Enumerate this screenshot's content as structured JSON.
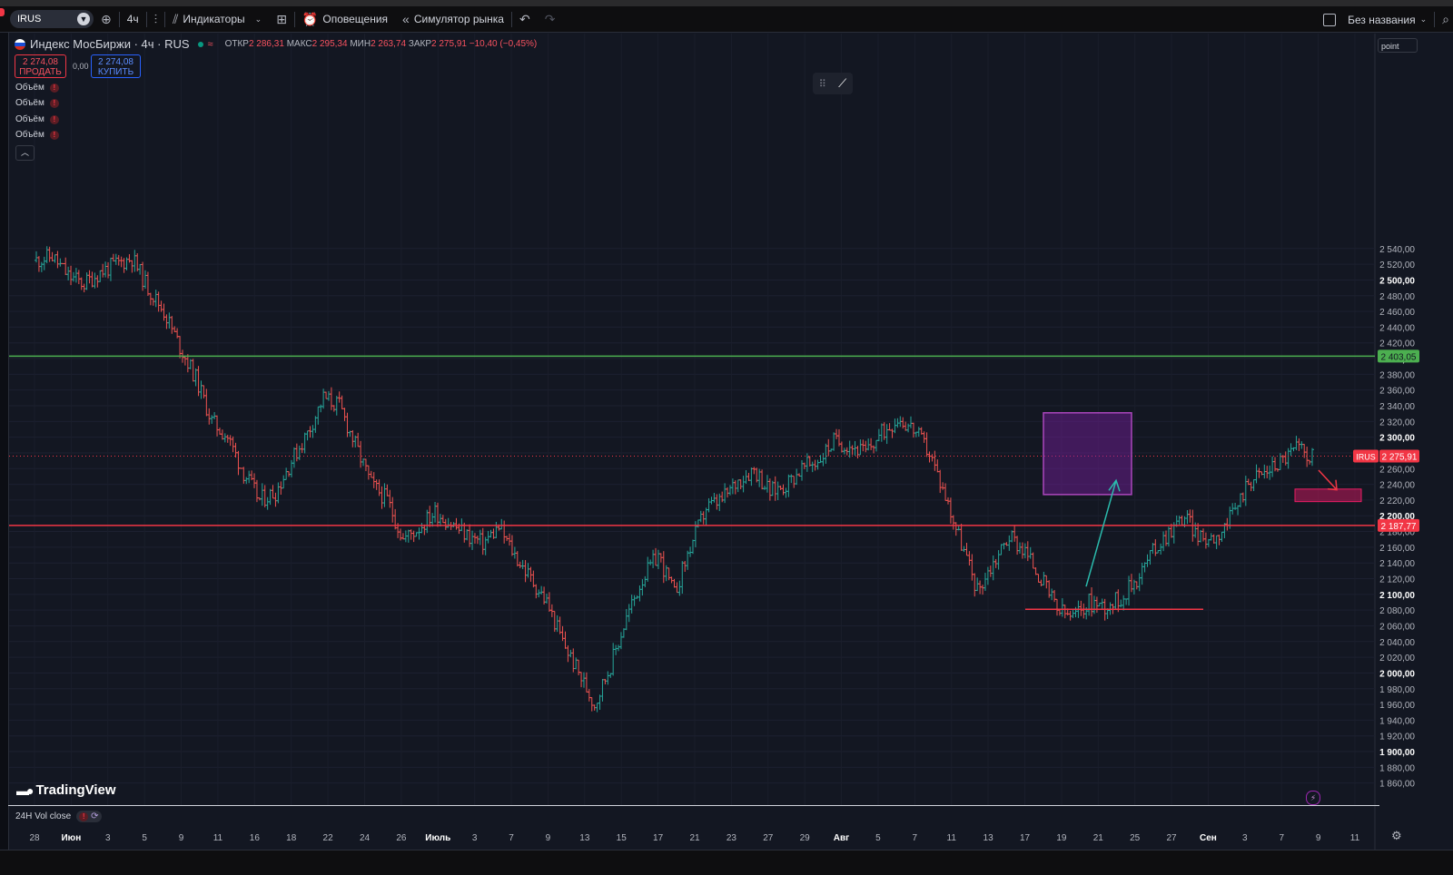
{
  "toolbar": {
    "symbol": "IRUS",
    "interval": "4ч",
    "indicators_label": "Индикаторы",
    "alerts_label": "Оповещения",
    "replay_label": "Симулятор рынка",
    "layout_name": "Без названия"
  },
  "legend": {
    "title": "Индекс МосБиржи · 4ч · RUS",
    "open_label": "ОТКР",
    "open": "2 286,31",
    "high_label": "МАКС",
    "high": "2 295,34",
    "low_label": "МИН",
    "low": "2 263,74",
    "close_label": "ЗАКР",
    "close": "2 275,91",
    "change": "−10,40 (−0,45%)",
    "approx_icon": "≈"
  },
  "trade": {
    "sell_price": "2 274,08",
    "sell_label": "ПРОДАТЬ",
    "spread": "0,00",
    "buy_price": "2 274,08",
    "buy_label": "КУПИТЬ"
  },
  "indicators": [
    {
      "label": "Объём"
    },
    {
      "label": "Объём"
    },
    {
      "label": "Объём"
    },
    {
      "label": "Объём"
    }
  ],
  "scale_mode": "point",
  "branding": "TradingView",
  "volume_pane": {
    "label": "24H Vol close"
  },
  "icons": {
    "add": "plus-circle-icon",
    "compare": "compare-icon",
    "indicators": "indicators-icon",
    "templates": "templates-icon",
    "alerts": "alarm-clock-icon",
    "replay": "rewind-icon",
    "undo": "undo-icon",
    "redo": "redo-icon",
    "drawing": "trend-line-icon",
    "settings": "gear-icon",
    "lightning": "lightning-icon"
  },
  "colors": {
    "background": "#131722",
    "up": "#26a69a",
    "down": "#ef5350",
    "resistance_line": "#4caf50",
    "support_line": "#f23645",
    "rectangle_fill": "#7b1fa2",
    "arrow_up": "#2bbbad",
    "arrow_down": "#f23645"
  },
  "chart_data": {
    "type": "ohlc",
    "title": "Индекс МосБиржи · 4ч · RUS",
    "ylim": [
      1840,
      2560
    ],
    "y_ticks": [
      "2 540,00",
      "2 520,00",
      "2 500,00",
      "2 480,00",
      "2 460,00",
      "2 440,00",
      "2 420,00",
      "2 400,00",
      "2 380,00",
      "2 360,00",
      "2 340,00",
      "2 320,00",
      "2 300,00",
      "2 280,00",
      "2 260,00",
      "2 240,00",
      "2 220,00",
      "2 200,00",
      "2 180,00",
      "2 160,00",
      "2 140,00",
      "2 120,00",
      "2 100,00",
      "2 080,00",
      "2 060,00",
      "2 040,00",
      "2 020,00",
      "2 000,00",
      "1 980,00",
      "1 960,00",
      "1 940,00",
      "1 920,00",
      "1 900,00",
      "1 880,00",
      "1 860,00"
    ],
    "x_ticks": [
      "28",
      "Июн",
      "3",
      "5",
      "9",
      "11",
      "16",
      "18",
      "22",
      "24",
      "26",
      "Июль",
      "3",
      "7",
      "9",
      "13",
      "15",
      "17",
      "21",
      "23",
      "27",
      "29",
      "Авг",
      "5",
      "7",
      "11",
      "13",
      "17",
      "19",
      "21",
      "25",
      "27",
      "Сен",
      "3",
      "7",
      "9",
      "11"
    ],
    "daily_closes": [
      2525,
      2530,
      2505,
      2495,
      2510,
      2520,
      2528,
      2490,
      2460,
      2415,
      2375,
      2320,
      2300,
      2255,
      2220,
      2230,
      2270,
      2305,
      2350,
      2340,
      2290,
      2240,
      2220,
      2170,
      2185,
      2205,
      2190,
      2175,
      2165,
      2185,
      2150,
      2120,
      2090,
      2040,
      2000,
      1960,
      2010,
      2070,
      2120,
      2150,
      2100,
      2160,
      2210,
      2220,
      2245,
      2260,
      2230,
      2240,
      2260,
      2270,
      2295,
      2290,
      2280,
      2305,
      2325,
      2310,
      2280,
      2225,
      2165,
      2105,
      2140,
      2175,
      2155,
      2120,
      2080,
      2070,
      2090,
      2085,
      2095,
      2120,
      2155,
      2180,
      2200,
      2170,
      2175,
      2200,
      2245,
      2255,
      2270,
      2286,
      2275.91
    ],
    "resistance_level": {
      "label": "2 403,05",
      "value": 2403.05
    },
    "support_level": {
      "label": "2 187,77",
      "value": 2187.77
    },
    "last_price": {
      "symbol": "IRUS",
      "label": "2 275,91",
      "value": 2275.91
    },
    "grid": true
  }
}
